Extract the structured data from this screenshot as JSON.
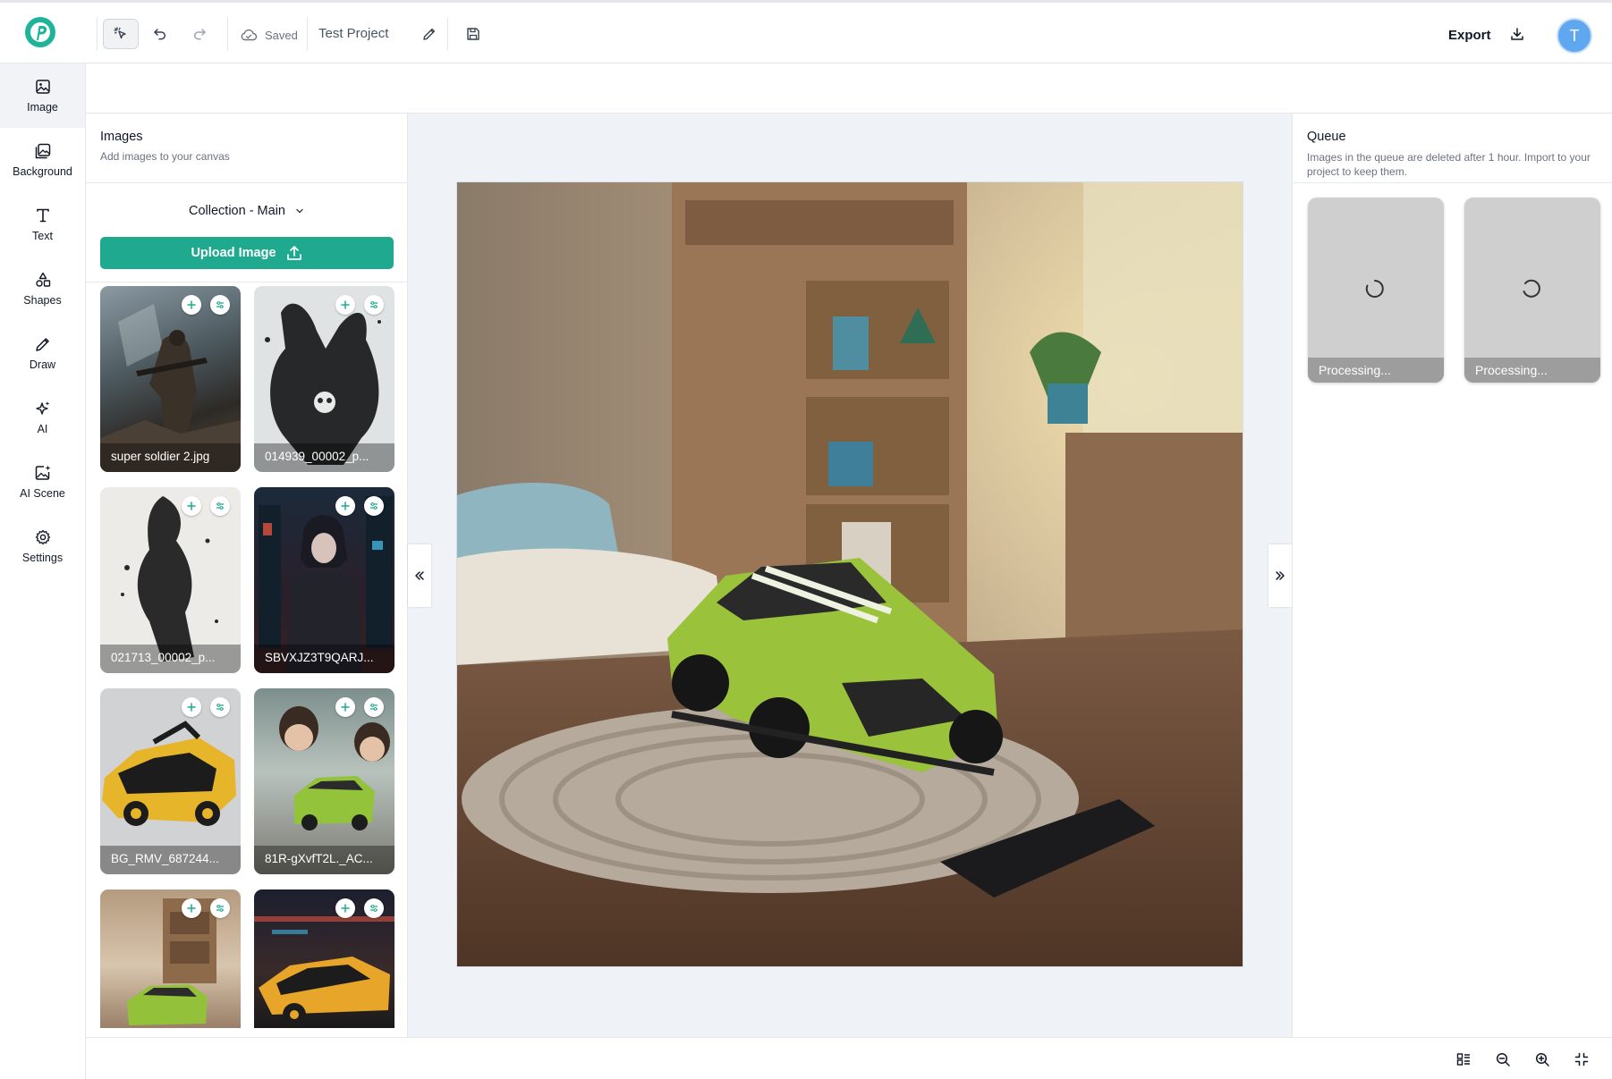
{
  "header": {
    "status": "Saved",
    "project_name": "Test Project",
    "export_label": "Export",
    "avatar_initial": "T"
  },
  "nav": {
    "items": [
      {
        "label": "Image",
        "icon": "image-icon"
      },
      {
        "label": "Background",
        "icon": "background-icon"
      },
      {
        "label": "Text",
        "icon": "text-icon"
      },
      {
        "label": "Shapes",
        "icon": "shapes-icon"
      },
      {
        "label": "Draw",
        "icon": "pencil-icon"
      },
      {
        "label": "AI",
        "icon": "sparkle-icon"
      },
      {
        "label": "AI Scene",
        "icon": "ai-scene-icon"
      },
      {
        "label": "Settings",
        "icon": "gear-icon"
      }
    ]
  },
  "images_panel": {
    "title": "Images",
    "subtitle": "Add images to your canvas",
    "collection": "Collection - Main",
    "upload_label": "Upload Image",
    "thumbnails": [
      {
        "label": "super soldier 2.jpg"
      },
      {
        "label": "014939_00002_p..."
      },
      {
        "label": "021713_00002_p..."
      },
      {
        "label": "SBVXJZ3T9QARJ..."
      },
      {
        "label": "BG_RMV_687244..."
      },
      {
        "label": "81R-gXvfT2L._AC..."
      },
      {
        "label": ""
      },
      {
        "label": ""
      }
    ]
  },
  "queue": {
    "title": "Queue",
    "subtitle": "Images in the queue are deleted after 1 hour. Import to your project to keep them.",
    "items": [
      {
        "label": "Processing..."
      },
      {
        "label": "Processing..."
      }
    ]
  },
  "colors": {
    "accent": "#1fa98f",
    "avatar": "#5fa8f0",
    "canvas_bg": "#eff2f7"
  }
}
